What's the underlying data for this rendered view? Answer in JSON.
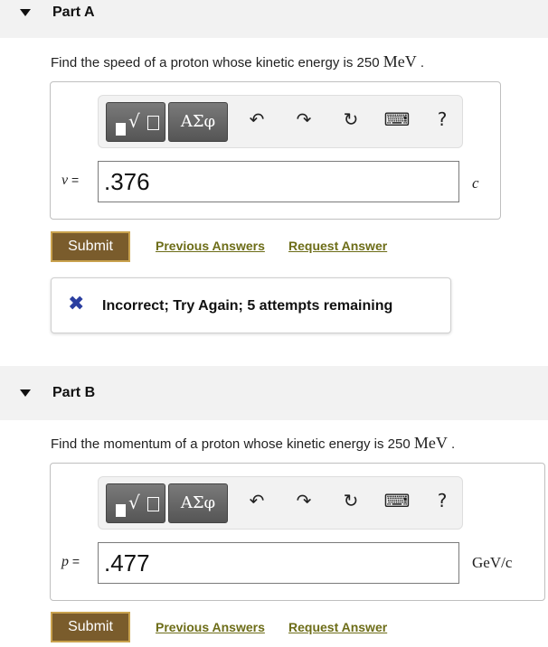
{
  "partA": {
    "title": "Part A",
    "question_prefix": "Find the speed of a proton whose kinetic energy is 250 ",
    "question_unit": "MeV",
    "question_suffix": " .",
    "variable": "v",
    "equals": " =",
    "answer_value": ".376",
    "unit": "c",
    "submit_label": "Submit",
    "previous_label": "Previous Answers",
    "request_label": "Request Answer",
    "feedback": "Incorrect; Try Again; 5 attempts remaining"
  },
  "partB": {
    "title": "Part B",
    "question_prefix": "Find the momentum of a proton whose kinetic energy is 250 ",
    "question_unit": "MeV",
    "question_suffix": " .",
    "variable": "p",
    "equals": " =",
    "answer_value": ".477",
    "unit": "GeV/c",
    "submit_label": "Submit",
    "previous_label": "Previous Answers",
    "request_label": "Request Answer"
  },
  "toolbar": {
    "symbols_label": "ΑΣφ",
    "radical_glyph": "√",
    "undo_glyph": "↶",
    "redo_glyph": "↷",
    "reset_glyph": "↻",
    "keyboard_glyph": "⌨",
    "help_glyph": "?"
  },
  "colors": {
    "submit_bg": "#7a5c2c",
    "submit_border": "#c9a24e",
    "link": "#6d6d18",
    "incorrect_icon": "#2a3ea0"
  },
  "icons": {
    "caret": "caret-down-icon",
    "templates": "templates-icon",
    "undo": "undo-icon",
    "redo": "redo-icon",
    "reset": "reset-icon",
    "keyboard": "keyboard-icon",
    "help": "help-icon",
    "incorrect": "x-icon"
  }
}
